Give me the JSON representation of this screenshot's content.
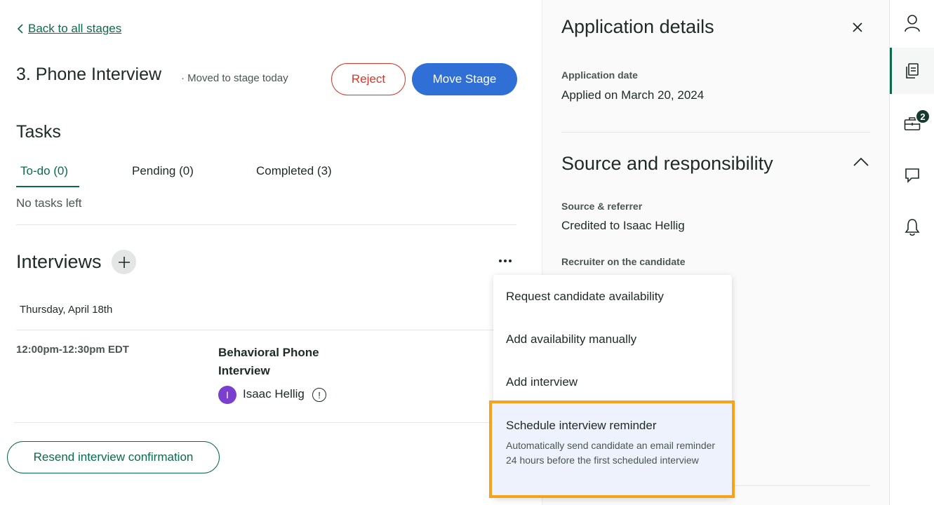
{
  "nav": {
    "back_label": "Back to all stages"
  },
  "stage": {
    "title": "3. Phone Interview",
    "meta": "· Moved to stage today",
    "reject_label": "Reject",
    "move_label": "Move Stage"
  },
  "tasks": {
    "heading": "Tasks",
    "tabs": [
      {
        "label": "To-do (0)",
        "active": true
      },
      {
        "label": "Pending (0)",
        "active": false
      },
      {
        "label": "Completed (3)",
        "active": false
      }
    ],
    "empty_text": "No tasks left"
  },
  "interviews": {
    "heading": "Interviews",
    "date": "Thursday, April 18th",
    "items": [
      {
        "time": "12:00pm-12:30pm EDT",
        "name": "Behavioral Phone Interview",
        "interviewer_initial": "I",
        "interviewer": "Isaac Hellig"
      }
    ],
    "resend_label": "Resend interview confirmation"
  },
  "menu": {
    "items": [
      {
        "label": "Request candidate availability"
      },
      {
        "label": "Add availability manually"
      },
      {
        "label": "Add interview"
      }
    ],
    "highlighted": {
      "label": "Schedule interview reminder",
      "description": "Automatically send candidate an email reminder 24 hours before the first scheduled interview"
    }
  },
  "panel": {
    "title": "Application details",
    "application_date_label": "Application date",
    "application_date_value": "Applied on March 20, 2024",
    "section_title": "Source and responsibility",
    "source_label": "Source & referrer",
    "source_value": "Credited to Isaac Hellig",
    "recruiter_label": "Recruiter on the candidate"
  },
  "rail": {
    "items": [
      {
        "icon": "person-icon"
      },
      {
        "icon": "documents-icon",
        "active": true
      },
      {
        "icon": "briefcase-icon",
        "badge": "2"
      },
      {
        "icon": "chat-icon"
      },
      {
        "icon": "bell-icon"
      }
    ]
  },
  "colors": {
    "brand_green": "#0b6a4c",
    "primary_blue": "#2f6fd6",
    "reject_red": "#d2372b",
    "highlight_orange": "#f6a21a",
    "avatar_purple": "#7b3fd0"
  }
}
